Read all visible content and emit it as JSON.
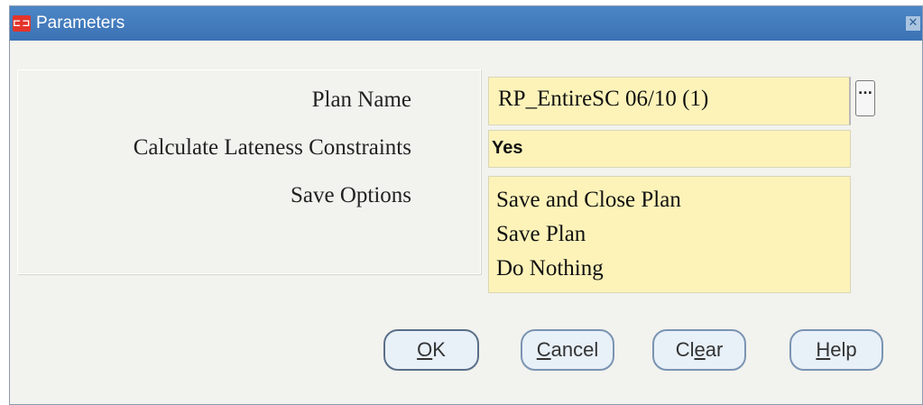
{
  "window": {
    "title": "Parameters",
    "app_icon": "oracle-forms-icon",
    "close_icon": "close-icon"
  },
  "form": {
    "plan_name": {
      "label": "Plan Name",
      "value": "RP_EntireSC 06/10 (1)"
    },
    "lateness": {
      "label": "Calculate Lateness Constraints",
      "value": "Yes"
    },
    "save_options": {
      "label": "Save Options",
      "items": [
        "Save and Close Plan",
        "Save Plan",
        "Do Nothing"
      ]
    },
    "lov_button_label": "..."
  },
  "buttons": {
    "ok": {
      "mnemonic": "O",
      "rest": "K"
    },
    "cancel": {
      "mnemonic": "C",
      "rest": "ancel"
    },
    "clear": {
      "before": "Cl",
      "mnemonic": "e",
      "rest": "ar"
    },
    "help": {
      "mnemonic": "H",
      "rest": "elp"
    }
  },
  "colors": {
    "titlebar": "#3b72b4",
    "field_background": "#fdf3b9",
    "window_background": "#f2f2ee"
  }
}
